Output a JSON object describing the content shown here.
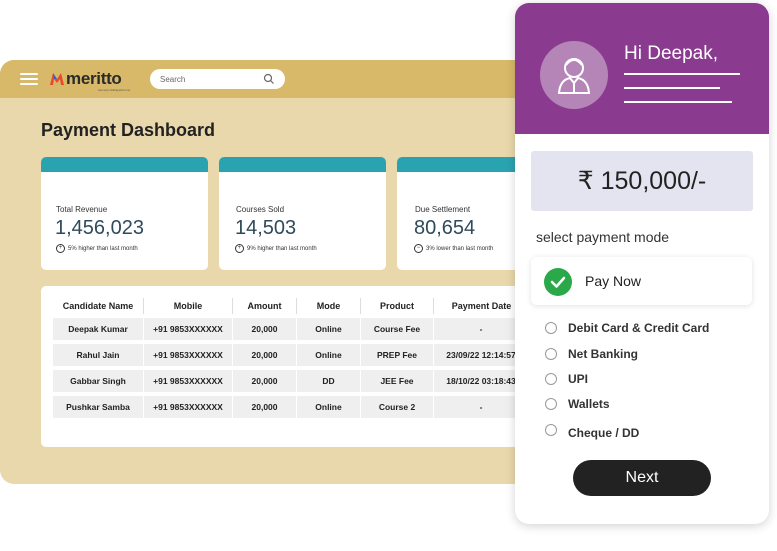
{
  "header": {
    "logo_text": "meritto",
    "logo_sub": "formerly NoPaperForms",
    "search_placeholder": "Search"
  },
  "dashboard": {
    "title": "Payment Dashboard",
    "cards": [
      {
        "label": "Total Revenue",
        "value": "1,456,023",
        "note": "5% higher than last month",
        "sym": "+"
      },
      {
        "label": "Courses Sold",
        "value": "14,503",
        "note": "9% higher than last month",
        "sym": "+"
      },
      {
        "label": "Due Settlement",
        "value": "80,654",
        "note": "3% lower than last month",
        "sym": "−"
      }
    ],
    "accent": "#2aa3b0"
  },
  "table": {
    "headers": [
      "Candidate Name",
      "Mobile",
      "Amount",
      "Mode",
      "Product",
      "Payment Date"
    ],
    "rows": [
      [
        "Deepak Kumar",
        "+91 9853XXXXXX",
        "20,000",
        "Online",
        "Course Fee",
        "-"
      ],
      [
        "Rahul Jain",
        "+91 9853XXXXXX",
        "20,000",
        "Online",
        "PREP Fee",
        "23/09/22 12:14:57"
      ],
      [
        "Gabbar Singh",
        "+91 9853XXXXXX",
        "20,000",
        "DD",
        "JEE Fee",
        "18/10/22 03:18:43"
      ],
      [
        "Pushkar Samba",
        "+91 9853XXXXXX",
        "20,000",
        "Online",
        "Course 2",
        "-"
      ]
    ]
  },
  "payment": {
    "greeting": "Hi Deepak,",
    "amount": "₹ 150,000/-",
    "mode_title": "select payment mode",
    "selected": "Pay Now",
    "options": [
      "Debit Card & Credit Card",
      "Net Banking",
      "UPI",
      "Wallets",
      "Cheque / DD"
    ],
    "next_label": "Next",
    "header_color": "#8a3a8f",
    "check_color": "#2aa84a"
  }
}
